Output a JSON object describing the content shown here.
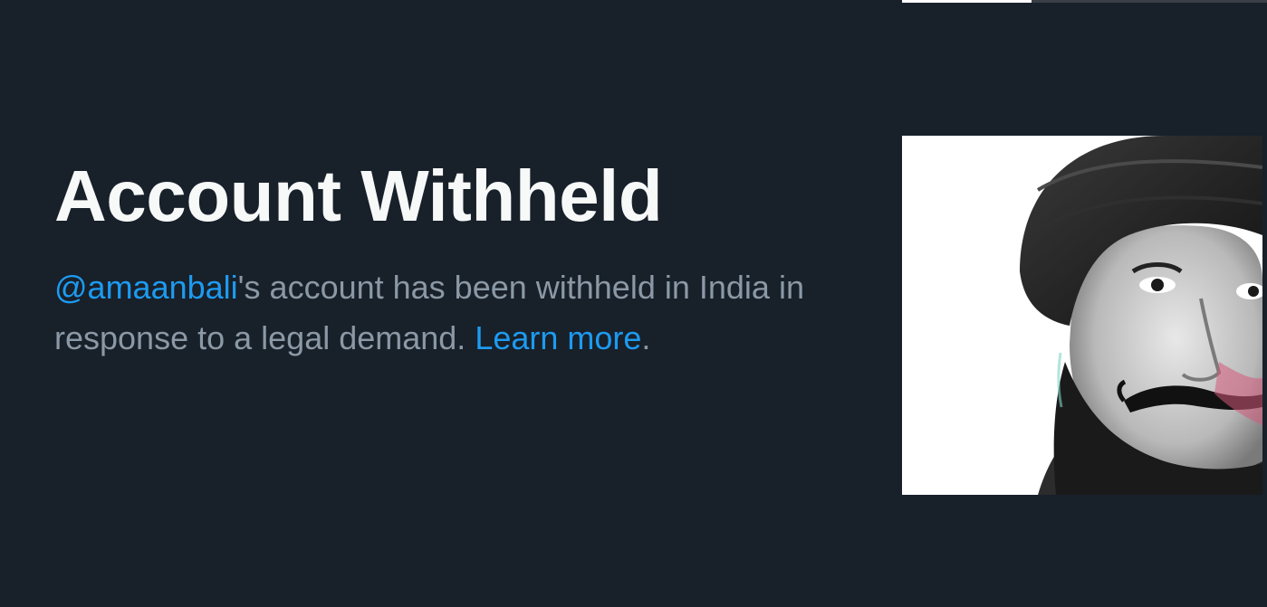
{
  "notice": {
    "title": "Account Withheld",
    "handle": "@amaanbali",
    "text_part1": "'s account has been withheld in India in response to a legal demand. ",
    "learn_more": "Learn more",
    "text_end": "."
  },
  "colors": {
    "background": "#18202a",
    "title": "#f7f9f9",
    "body_text": "#8b98a5",
    "link": "#1d9bf0"
  },
  "avatar": {
    "icon": "profile-photo"
  }
}
